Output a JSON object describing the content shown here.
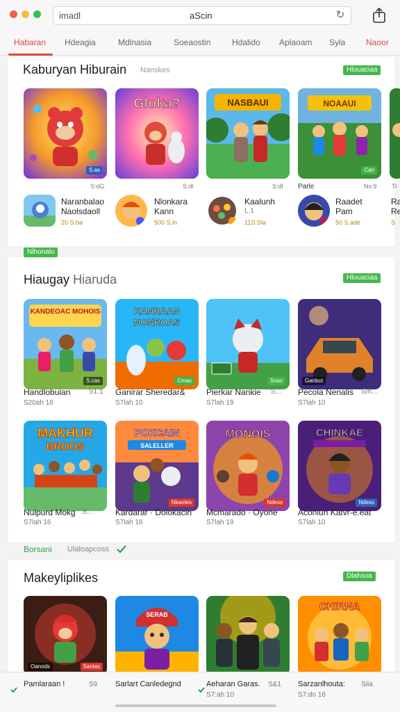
{
  "window": {
    "colors": {
      "close": "#f25c53",
      "minimize": "#f6be3b",
      "maximize": "#35c14a",
      "accent": "#e2463c",
      "badge": "#43b84a"
    }
  },
  "address_bar": {
    "left_text": "imadl",
    "center_text": "aScin"
  },
  "tabs": [
    "Habaran",
    "Hdeagia",
    "Mdlnasia",
    "Soeaostin",
    "Hdalido",
    "Aplaoam",
    "Syla",
    "Naoor"
  ],
  "section1": {
    "title": "Kaburyan Hiburain",
    "subtitle": "Nanskes",
    "badge": "Hlouaciaa",
    "card_prices": [
      "S:dG",
      "S:dl",
      "S:dl",
      "Parle",
      "Nx:9",
      "Ti"
    ],
    "apps": [
      {
        "name1": "Naranbalao",
        "name2": "Naolsdaoll",
        "meta": "20 S.ba"
      },
      {
        "name1": "Nlonkara",
        "name2": "Kann",
        "meta": "500 S.ln"
      },
      {
        "name1": "Kaalunh",
        "name2": "L.1",
        "meta": "11S:Sla"
      },
      {
        "name1": "Raadet",
        "name2": "Pam",
        "meta": "50 S.ade"
      },
      {
        "name1": "Ra",
        "name2": "Re",
        "meta": "S"
      }
    ],
    "after_badge": "Nlhonalo"
  },
  "section2": {
    "title": "Hiaugay",
    "title_light": "Hiaruda",
    "badge": "Hlouaciaa",
    "row1": [
      {
        "label": "Handlobuian",
        "price2": "S1.1",
        "price": "S20ah 16"
      },
      {
        "label": "Ganirar Sheredar&",
        "price": "S7lah 10"
      },
      {
        "label": "Pierkar Nankie",
        "price2": "S...",
        "price": "S7lah 19"
      },
      {
        "label": "Pecola Nenalis",
        "price2": "S/h...",
        "price": "S7lah 10"
      }
    ],
    "row2": [
      {
        "label": "Nulpurd Mokg",
        "price2": "S...",
        "price": "S7lah 16"
      },
      {
        "label": "Kardarar · Dolokacin",
        "price": "S7lah 16"
      },
      {
        "label": "Mcmarado · Oyone",
        "price": "S7lah 19"
      },
      {
        "label": "Aconiun Katvr-e.eat",
        "price": "S7lah 10"
      }
    ],
    "card_texts": [
      "KANDEOAC MOHOIS",
      "KANRAAN NONROAS",
      "",
      "",
      "MAKHUR BROOS",
      "POKCAIN SALELLER",
      "MONOIS",
      "CHINKAE"
    ],
    "card_tags": [
      "S.cas",
      "Cmas",
      "Snas",
      "Ganbot",
      "",
      "Nkaotes",
      "Ndess",
      "Ndess"
    ]
  },
  "recommend": {
    "green": "Borsani",
    "light": "Ulaloapcoss"
  },
  "section3": {
    "title": "Makeyliplikes",
    "badge": "Dlahsoa",
    "card_texts": [
      "",
      "SERAB",
      "",
      "CHIRNA"
    ],
    "card_tags": [
      "Oanods",
      "Sanlas",
      "",
      ""
    ],
    "items": [
      {
        "label": "Pamlaraan !",
        "price2": "S9"
      },
      {
        "label": "Sarlart Canledegnd"
      },
      {
        "label": "Aeharan Garas.",
        "price2": "S&1",
        "price": "S7:ah 10"
      },
      {
        "label": "Sarzanlhouta:",
        "price2": "Sila",
        "price": "S7:dn 16"
      }
    ]
  }
}
